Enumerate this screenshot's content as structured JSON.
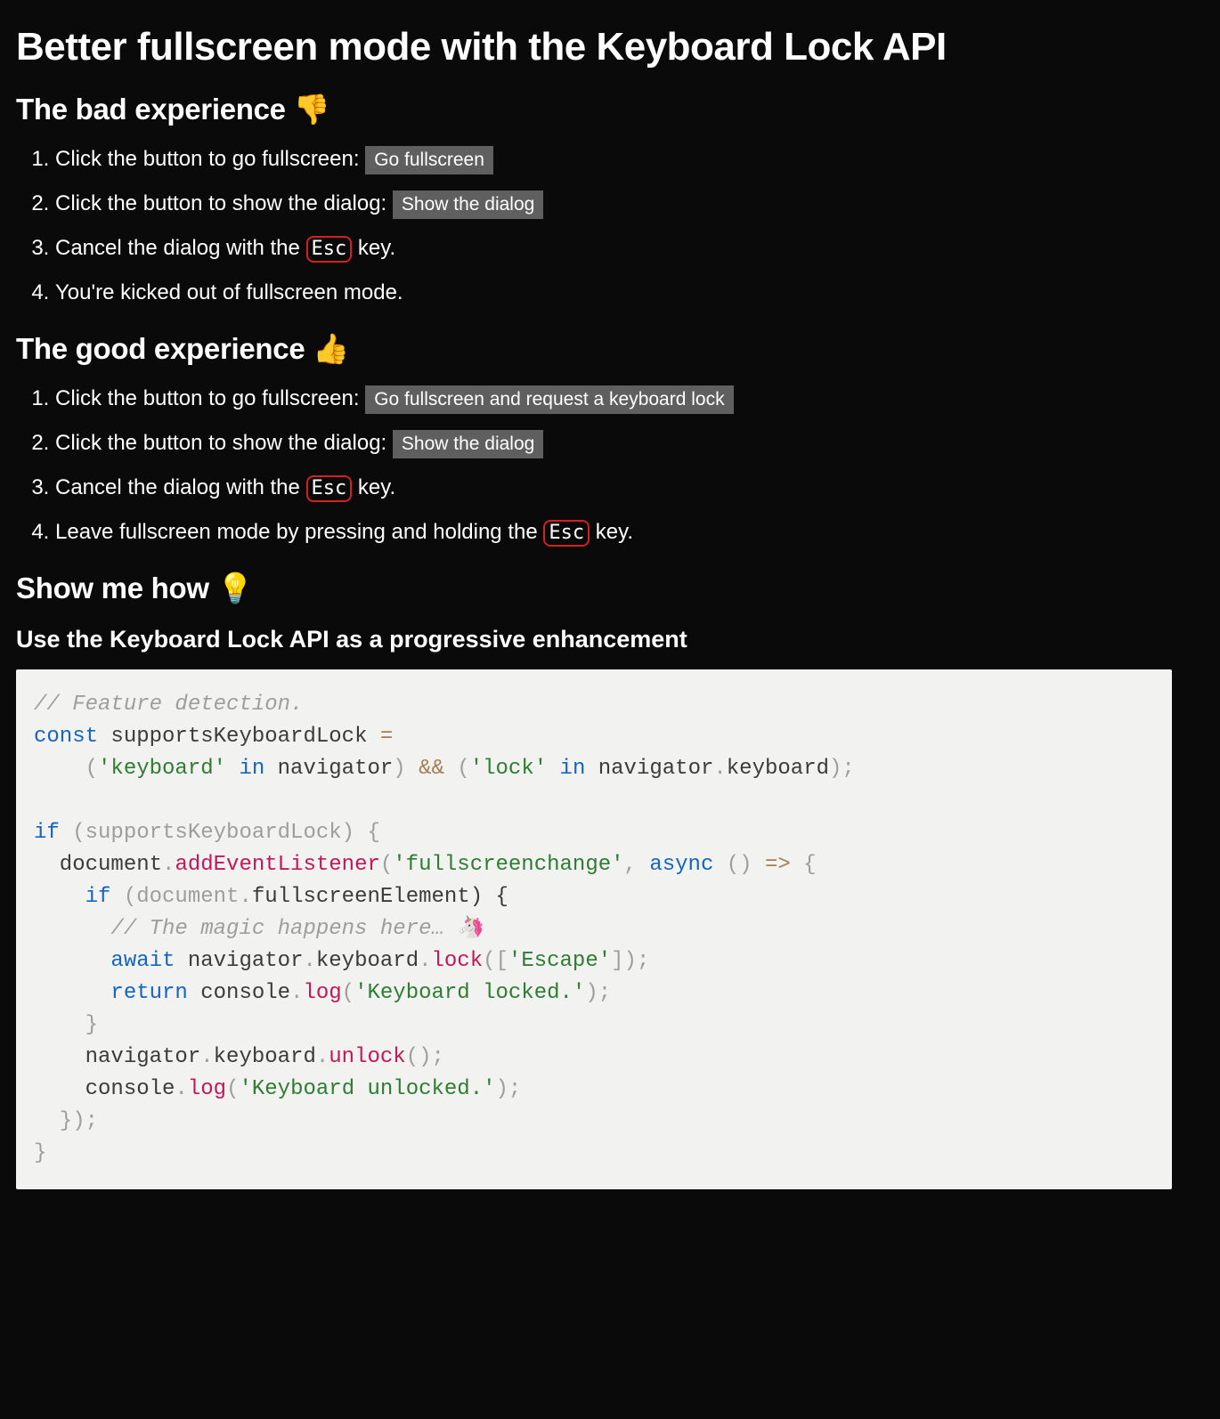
{
  "title": "Better fullscreen mode with the Keyboard Lock API",
  "bad": {
    "heading": "The bad experience 👎",
    "step1_text": "Click the button to go fullscreen: ",
    "step1_btn": "Go fullscreen",
    "step2_text": "Click the button to show the dialog: ",
    "step2_btn": "Show the dialog",
    "step3_pre": "Cancel the dialog with the ",
    "step3_kbd": "Esc",
    "step3_post": " key.",
    "step4": "You're kicked out of fullscreen mode."
  },
  "good": {
    "heading": "The good experience 👍",
    "step1_text": "Click the button to go fullscreen: ",
    "step1_btn": "Go fullscreen and request a keyboard lock",
    "step2_text": "Click the button to show the dialog: ",
    "step2_btn": "Show the dialog",
    "step3_pre": "Cancel the dialog with the ",
    "step3_kbd": "Esc",
    "step3_post": " key.",
    "step4_pre": "Leave fullscreen mode by pressing and holding the ",
    "step4_kbd": "Esc",
    "step4_post": " key."
  },
  "how": {
    "heading": "Show me how 💡",
    "subheading": "Use the Keyboard Lock API as a progressive enhancement"
  },
  "code": {
    "c1": "// Feature detection.",
    "kw_const": "const",
    "id_supports": " supportsKeyboardLock ",
    "op_eq": "=",
    "p_open1": "    (",
    "str_keyboard": "'keyboard'",
    "kw_in1": " in ",
    "id_nav1": "navigator",
    "p_close_and": ") ",
    "op_and": "&&",
    "p_open2": " (",
    "str_lock": "'lock'",
    "kw_in2": " in ",
    "id_nav2": "navigator",
    "dot1": ".",
    "id_kb1": "keyboard",
    "p_close2": ");",
    "kw_if": "if",
    "p_if": " (supportsKeyboardLock) {",
    "id_doc1": "  document",
    "dot2": ".",
    "fn_add": "addEventListener",
    "p_add_open": "(",
    "str_fsc": "'fullscreenchange'",
    "p_comma": ", ",
    "kw_async": "async",
    "p_arrow": " () ",
    "op_arrow": "=>",
    "p_brace": " {",
    "kw_if2": "    if",
    "p_if2": " (document",
    "dot3": ".",
    "id_fse": "fullscreenElement) {",
    "c2": "      // The magic happens here… 🦄",
    "kw_await": "      await",
    "sp": " ",
    "id_nav3": "navigator",
    "dot4": ".",
    "id_kb2": "keyboard",
    "dot5": ".",
    "fn_lock": "lock",
    "p_lock": "([",
    "str_esc": "'Escape'",
    "p_lock2": "]);",
    "kw_return": "      return",
    "id_console1": " console",
    "dot6": ".",
    "fn_log1": "log",
    "p_log1o": "(",
    "str_locked": "'Keyboard locked.'",
    "p_log1c": ");",
    "p_cbrace1": "    }",
    "id_nav4": "    navigator",
    "dot7": ".",
    "id_kb3": "keyboard",
    "dot8": ".",
    "fn_unlock": "unlock",
    "p_unlock": "();",
    "id_console2": "    console",
    "dot9": ".",
    "fn_log2": "log",
    "p_log2o": "(",
    "str_unlocked": "'Keyboard unlocked.'",
    "p_log2c": ");",
    "p_cbrace2": "  });",
    "p_cbrace3": "}"
  }
}
